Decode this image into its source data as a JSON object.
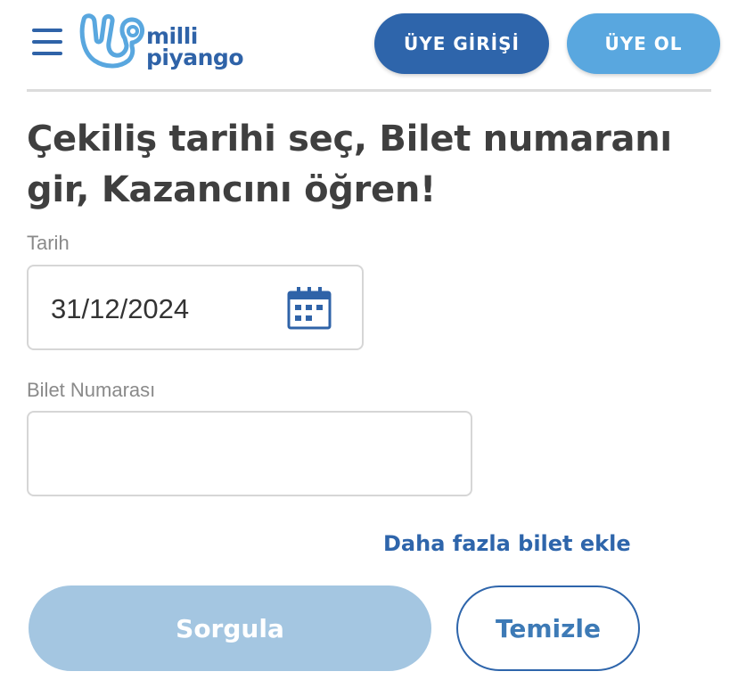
{
  "header": {
    "logo_line1": "milli",
    "logo_line2": "piyango",
    "login_label": "ÜYE GİRİŞİ",
    "register_label": "ÜYE OL"
  },
  "form": {
    "title": "Çekiliş tarihi seç, Bilet numaranı gir, Kazancını öğren!",
    "date_label": "Tarih",
    "date_value": "31/12/2024",
    "ticket_label": "Bilet Numarası",
    "ticket_value": "",
    "add_more_label": "Daha fazla bilet ekle",
    "query_label": "Sorgula",
    "clear_label": "Temizle"
  },
  "colors": {
    "primary": "#2e65ab",
    "secondary": "#59a7df",
    "disabled_button": "#a4c6e1",
    "title_text": "#3f3f3f",
    "label_text": "#8a8a8a"
  },
  "icons": {
    "menu": "hamburger-menu-icon",
    "calendar": "calendar-icon",
    "logo": "milli-piyango-logo-mark"
  }
}
